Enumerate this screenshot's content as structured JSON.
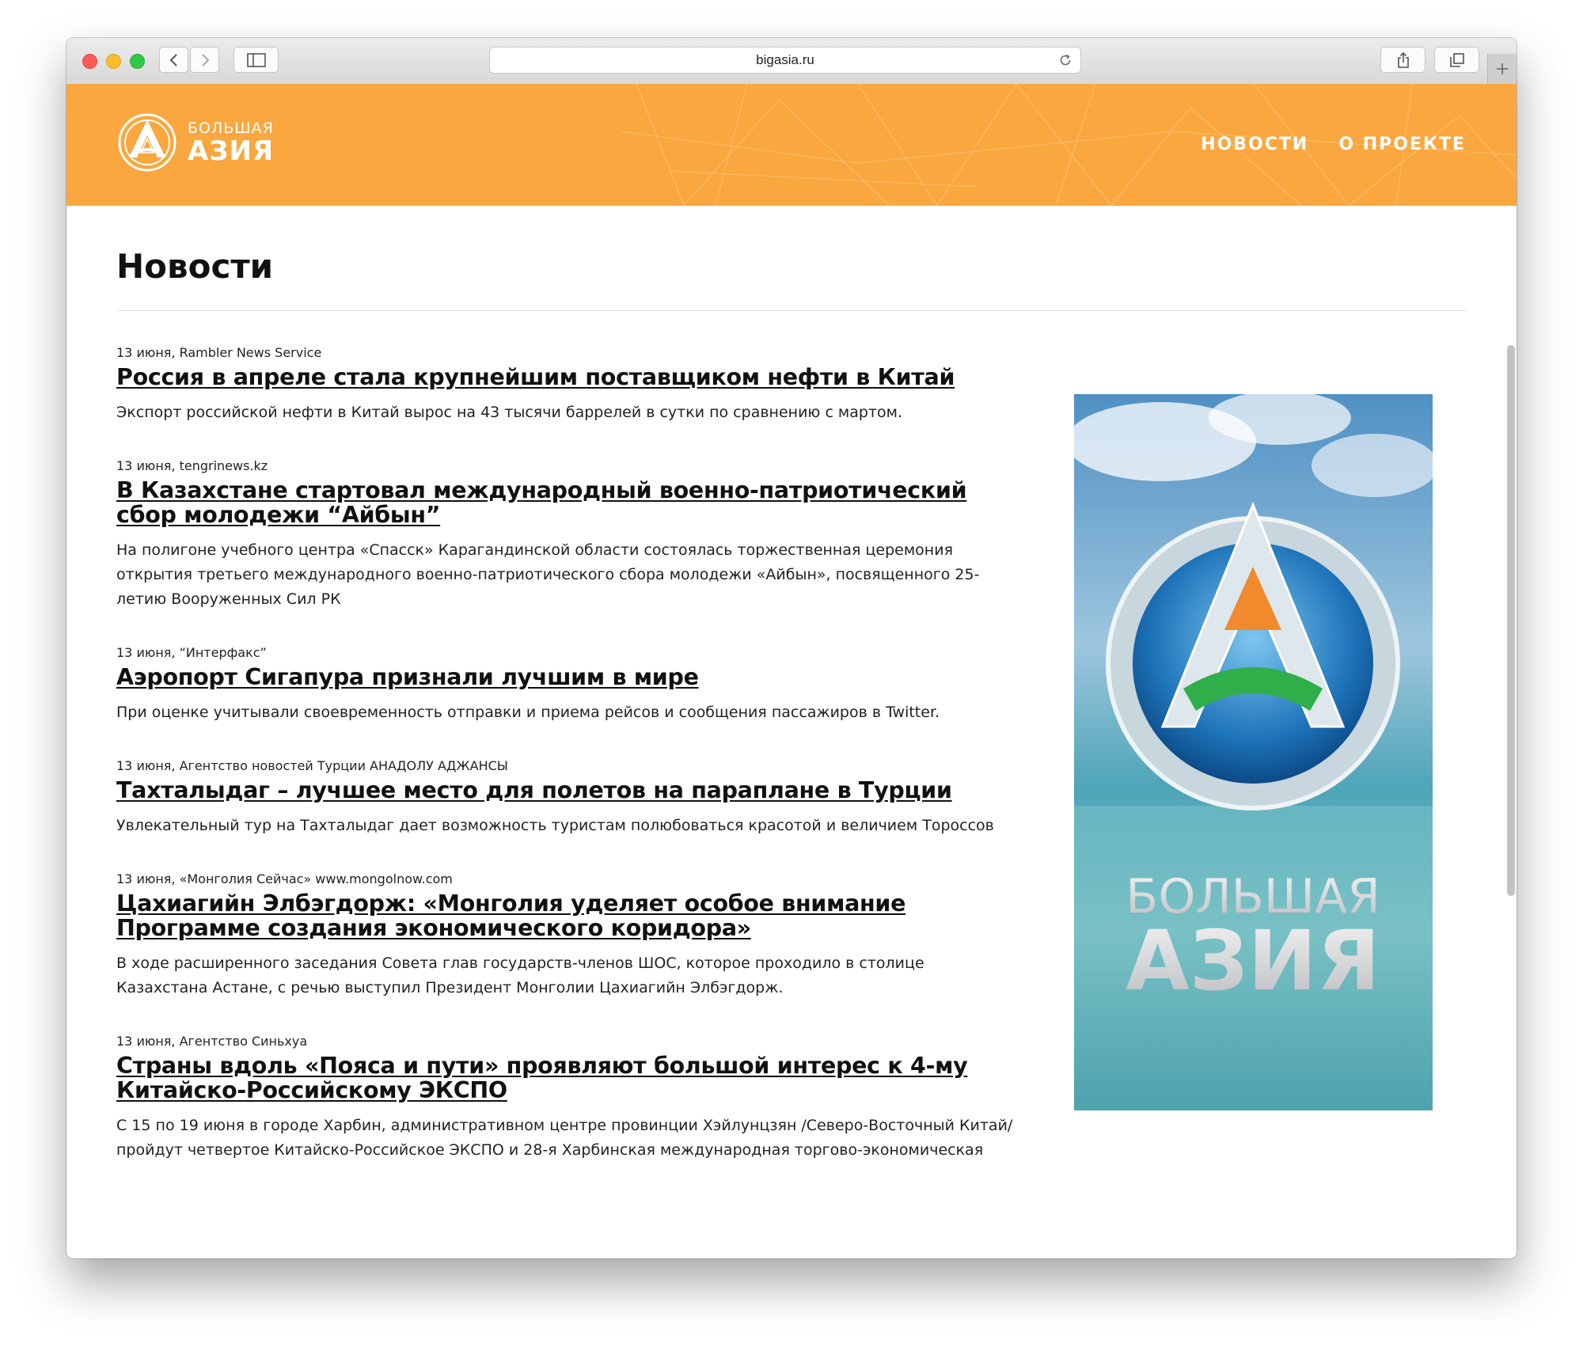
{
  "browser": {
    "url": "bigasia.ru"
  },
  "site": {
    "logo_small": "БОЛЬШАЯ",
    "logo_big": "АЗИЯ",
    "nav": [
      "НОВОСТИ",
      "О ПРОЕКТЕ"
    ],
    "brand_color": "#f9a73e"
  },
  "page": {
    "title": "Новости"
  },
  "news": [
    {
      "meta": "13 июня, Rambler News Service",
      "title": "Россия в апреле стала крупнейшим поставщиком нефти в Китай",
      "desc": "Экспорт российской нефти в Китай вырос на 43 тысячи баррелей в сутки по сравнению с мартом."
    },
    {
      "meta": "13 июня, tengrinews.kz",
      "title": "В Казахстане стартовал международный военно-патриотический сбор молодежи “Айбын”",
      "desc": "На полигоне учебного центра «Спасск» Карагандинской области состоялась торжественная церемония открытия третьего международного военно-патриотического сбора молодежи «Айбын», посвященного 25-летию Вооруженных Сил РК"
    },
    {
      "meta": "13 июня, “Интерфакс”",
      "title": "Аэропорт Сигапура признали лучшим в мире",
      "desc": "При оценке учитывали своевременность отправки и приема рейсов и сообщения пассажиров в Twitter."
    },
    {
      "meta": "13 июня, Агентство новостей Турции АНАДОЛУ АДЖАНСЫ",
      "title": "Тахталыдаг – лучшее место для полетов на параплане в Турции",
      "desc": "Увлекательный тур на Тахталыдаг дает возможность туристам полюбоваться красотой и величием Тороссов"
    },
    {
      "meta": "13 июня, «Монголия Сейчас» www.mongolnow.com",
      "title": "Цахиагийн Элбэгдорж: «Монголия уделяет особое внимание Программе создания экономического коридора»",
      "desc": "В ходе расширенного заседания Совета глав государств-членов ШОС, которое проходило в столице Казахстана Астане, с речью выступил Президент Монголии Цахиагийн Элбэгдорж."
    },
    {
      "meta": "13 июня, Агентство Синьхуа",
      "title": "Страны вдоль «Пояса и пути» проявляют большой интерес к 4-му Китайско-Российскому ЭКСПО",
      "desc": "С 15 по 19 июня в городе Харбин, административном центре провинции Хэйлунцзян /Северо-Восточный Китай/ пройдут четвертое Китайско-Российское ЭКСПО и 28-я Харбинская международная торгово-экономическая"
    }
  ],
  "banner": {
    "text_small": "БОЛЬШАЯ",
    "text_big": "АЗИЯ"
  }
}
